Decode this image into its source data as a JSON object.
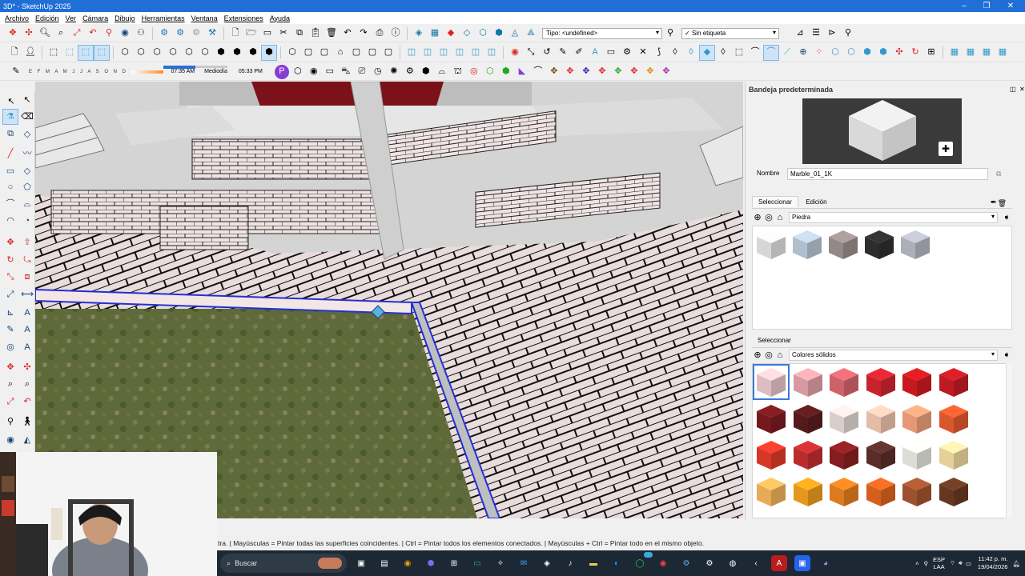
{
  "window": {
    "title": "3D* - SketchUp 2025",
    "controls": [
      "–",
      "❐",
      "✕"
    ]
  },
  "menu": [
    "Archivo",
    "Edición",
    "Ver",
    "Cámara",
    "Dibujo",
    "Herramientas",
    "Ventana",
    "Extensiones",
    "Ayuda"
  ],
  "toolbar": {
    "tag_type_select": "Tipo: <undefined>",
    "tag_select": "Sin etiqueta",
    "tag_check": "✓"
  },
  "shadows": {
    "months": "E F M A M J J A S O N D",
    "time_start": "07:35 AM",
    "time_mid": "Mediodía",
    "time_end": "05:33 PM"
  },
  "tray": {
    "title": "Bandeja predeterminada",
    "name_label": "Nombre",
    "material_name": "Marble_01_1K",
    "tab_select": "Seleccionar",
    "tab_edit": "Edición",
    "library_top": "Piedra",
    "select_label_bottom": "Seleccionar",
    "library_bottom": "Colores sólidos",
    "stone_swatches": [
      "#e2e2e2",
      "#b9c9d8",
      "#9c9090",
      "#2f2f2f",
      "#b6b8c2"
    ],
    "solid_swatches": [
      [
        "#e9c7cc",
        "#e2a2aa",
        "#d9676f",
        "#d3242f",
        "#d11a1f",
        "#c81b25"
      ],
      [
        "#7a1a20",
        "#5b1b1f",
        "#e4d9d6",
        "#f0c5b0",
        "#f0a07a",
        "#e55a2f"
      ],
      [
        "#e23a2a",
        "#c42e2e",
        "#8c1f22",
        "#5d2e2a",
        "#e9e9e2",
        "#f2dba2"
      ],
      [
        "#f3b45a",
        "#f0a01f",
        "#e8801f",
        "#e0651f",
        "#a45630",
        "#6b3a22"
      ]
    ]
  },
  "status_text": "tra. | Mayúsculas = Pintar todas las superficies coincidentes. | Ctrl = Pintar todos los elementos conectados. | Mayúsculas + Ctrl = Pintar todo en el mismo objeto.",
  "taskbar": {
    "search_placeholder": "Buscar",
    "lang": "ESP",
    "lang_sub": "LAA",
    "time": "11:42 p. m.",
    "date": "19/04/2026",
    "badge": "42"
  }
}
